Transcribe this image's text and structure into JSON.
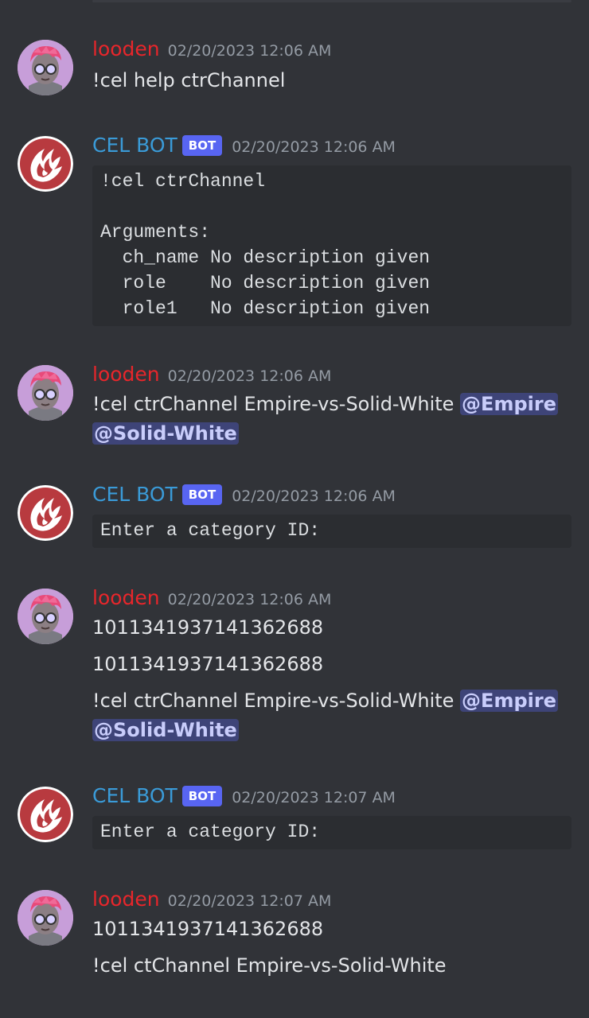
{
  "colors": {
    "background": "#313338",
    "user_color": "#e8262b",
    "bot_color": "#3a9bd8",
    "bot_tag": "#5865f2",
    "mention_bg": "#4a4f8c"
  },
  "messages": [
    {
      "author": "looden",
      "timestamp": "02/20/2023 12:06 AM",
      "lines": [
        "!cel help ctrChannel"
      ]
    },
    {
      "author": "CEL BOT",
      "bot_tag": "BOT",
      "timestamp": "02/20/2023 12:06 AM",
      "code": "!cel ctrChannel\n\nArguments:\n  ch_name No description given\n  role    No description given\n  role1   No description given"
    },
    {
      "author": "looden",
      "timestamp": "02/20/2023 12:06 AM",
      "line1_text": "!cel ctrChannel Empire-vs-Solid-White ",
      "mention1": "@Empire",
      "mention2": "@Solid-White"
    },
    {
      "author": "CEL BOT",
      "bot_tag": "BOT",
      "timestamp": "02/20/2023 12:06 AM",
      "code": "Enter a category ID:"
    },
    {
      "author": "looden",
      "timestamp": "02/20/2023 12:06 AM",
      "line1": "1011341937141362688",
      "line2": "1011341937141362688",
      "line3_text": "!cel ctrChannel Empire-vs-Solid-White ",
      "mention1": "@Empire",
      "mention2": "@Solid-White"
    },
    {
      "author": "CEL BOT",
      "bot_tag": "BOT",
      "timestamp": "02/20/2023 12:07 AM",
      "code": "Enter a category ID:"
    },
    {
      "author": "looden",
      "timestamp": "02/20/2023 12:07 AM",
      "line1": "1011341937141362688",
      "line2": "!cel ctChannel Empire-vs-Solid-White"
    }
  ]
}
